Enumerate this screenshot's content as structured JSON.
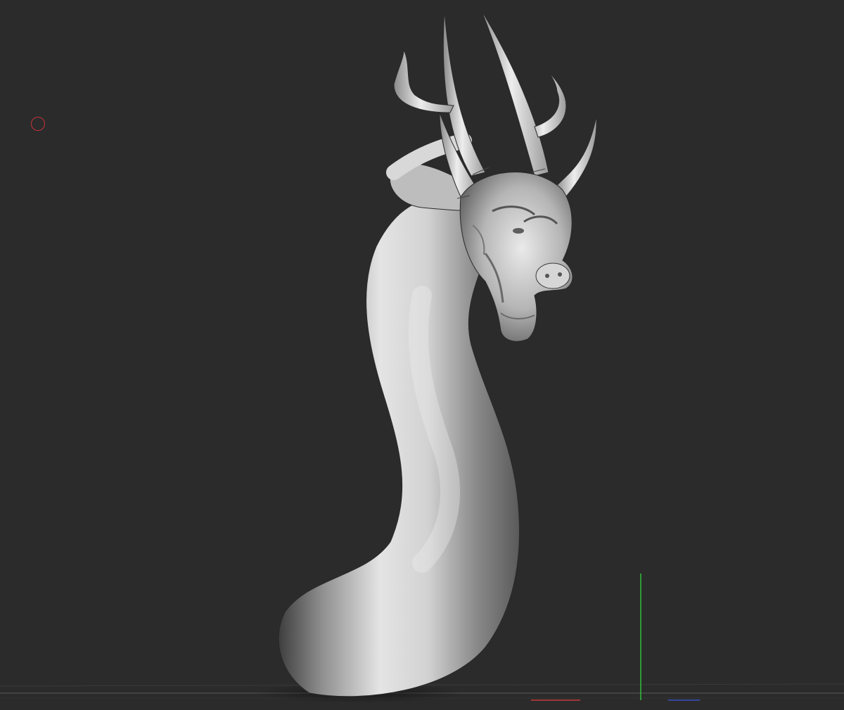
{
  "viewport": {
    "background": "#2b2b2b",
    "model_shading": "matcap grey",
    "icons": {
      "brush_cursor": "brush-cursor-icon",
      "axis_gizmo": "axis-gizmo"
    },
    "colors": {
      "model_light": "#e6e6e6",
      "model_mid": "#9a9a9a",
      "model_dark": "#3a3a3a",
      "y_axis": "#2fbf3a",
      "x_axis": "#c43a3a",
      "z_axis": "#3a4fc4",
      "cursor": "#c2343a",
      "ground_line": "#5a5a5a"
    }
  }
}
